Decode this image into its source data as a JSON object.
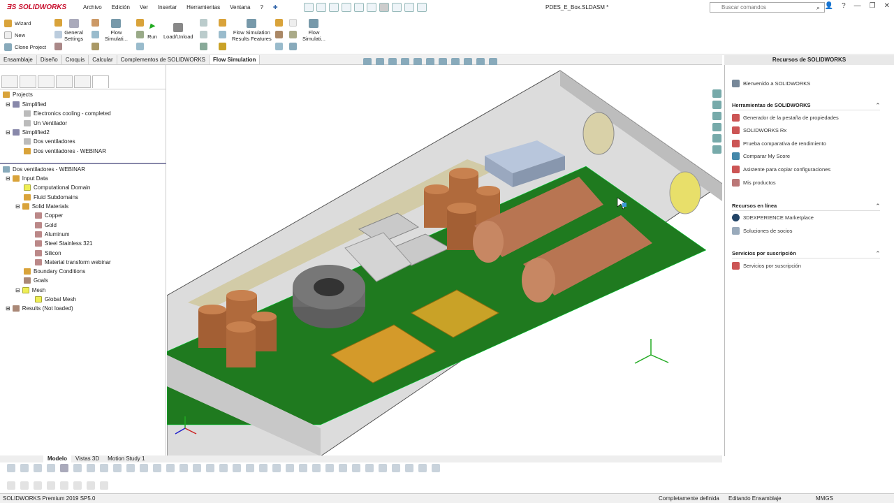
{
  "app": {
    "brand": "SOLIDWORKS",
    "doc_title": "PDES_E_Box.SLDASM *",
    "search_placeholder": "Buscar comandos"
  },
  "menu": [
    "Archivo",
    "Edición",
    "Ver",
    "Insertar",
    "Herramientas",
    "Ventana"
  ],
  "ribbon": {
    "wizard": "Wizard",
    "new": "New",
    "clone": "Clone Project",
    "general": "General\nSettings",
    "flow1": "Flow\nSimulati...",
    "run": "Run",
    "loadunload": "Load/Unload",
    "flow_results": "Flow Simulation\nResults Features",
    "flow2": "Flow\nSimulati..."
  },
  "tabs": [
    "Ensamblaje",
    "Diseño",
    "Croquis",
    "Calcular",
    "Complementos de SOLIDWORKS",
    "Flow Simulation"
  ],
  "tree_top": {
    "projects": "Projects",
    "simplified": "Simplified",
    "ec": "Electronics cooling - completed",
    "uv": "Un Ventilador",
    "simplified2": "Simplified2",
    "dv": "Dos ventiladores",
    "dvw": "Dos ventiladores - WEBINAR"
  },
  "tree_bottom": {
    "root": "Dos ventiladores - WEBINAR",
    "input": "Input Data",
    "cd": "Computational Domain",
    "fs": "Fluid Subdomains",
    "sm": "Solid Materials",
    "cu": "Copper",
    "au": "Gold",
    "al": "Aluminum",
    "ss": "Steel Stainless 321",
    "si": "Silicon",
    "mt": "Material transform webinar",
    "bc": "Boundary Conditions",
    "goals": "Goals",
    "mesh": "Mesh",
    "gm": "Global Mesh",
    "results": "Results (Not loaded)"
  },
  "rpanel": {
    "title": "Recursos de SOLIDWORKS",
    "welcome": "Bienvenido a SOLIDWORKS",
    "sec1": "Herramientas de SOLIDWORKS",
    "gen": "Generador de la pestaña de propiedades",
    "rx": "SOLIDWORKS Rx",
    "bench": "Prueba comparativa de rendimiento",
    "score": "Comparar My Score",
    "copy": "Asistente para copiar configuraciones",
    "myprod": "Mis productos",
    "sec2": "Recursos en línea",
    "market": "3DEXPERIENCE Marketplace",
    "partners": "Soluciones de socios",
    "sec3": "Servicios por suscripción",
    "subs": "Servicios por suscripción"
  },
  "bottom_tabs": [
    "Modelo",
    "Vistas 3D",
    "Motion Study 1"
  ],
  "status": {
    "product": "SOLIDWORKS Premium 2019 SP5.0",
    "state": "Completamente definida",
    "mode": "Editando Ensamblaje",
    "units": "MMGS"
  },
  "colors": {
    "brand": "#c8102e",
    "pcb": "#1f7a1f",
    "copper": "#b06a3c",
    "gold": "#c9a227"
  }
}
